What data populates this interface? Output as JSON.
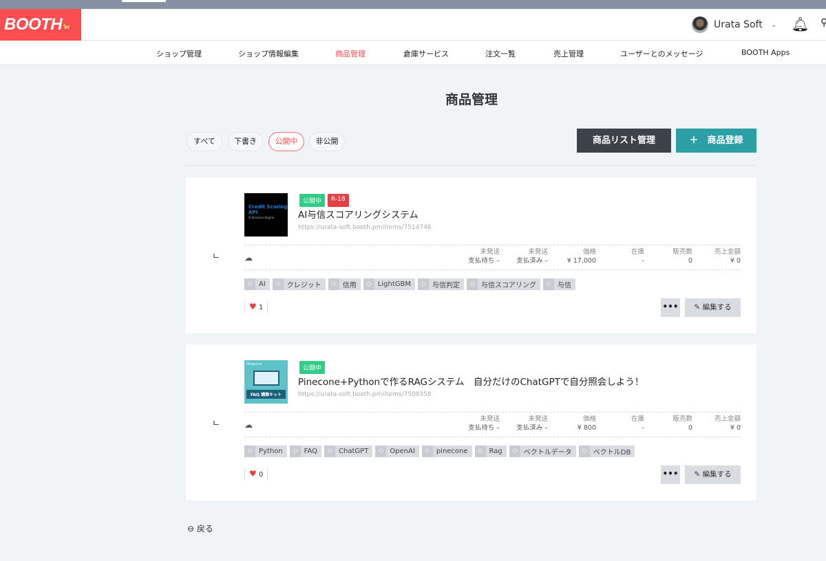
{
  "header": {
    "logo": "BOOTH",
    "user_name": "Urata Soft"
  },
  "nav": [
    "ショップ管理",
    "ショップ情報編集",
    "商品管理",
    "倉庫サービス",
    "注文一覧",
    "売上管理",
    "ユーザーとのメッセージ",
    "BOOTH Apps"
  ],
  "page_title": "商品管理",
  "filters": [
    "すべて",
    "下書き",
    "公開中",
    "非公開"
  ],
  "buttons": {
    "list_manage": "商品リスト管理",
    "register": "＋　商品登録",
    "more": "•••",
    "edit": "編集する",
    "back": "戻る"
  },
  "stat_labels": {
    "unshipped_wait": "未発送",
    "unshipped_wait2": "支払待ち –",
    "unshipped_paid": "未発送",
    "unshipped_paid2": "支払済み –",
    "price": "価格",
    "stock": "在庫",
    "sold": "販売数",
    "revenue": "売上金額"
  },
  "items": [
    {
      "status": "公開中",
      "rating": "R-18",
      "title": "AI与信スコアリングシステム",
      "url": "https://urata-soft.booth.pm/items/7514746",
      "thumb_text": "Credit Scoring API",
      "thumb_sub": "AI Decision Engine",
      "price": "¥ 17,000",
      "stock": "-",
      "sold": "0",
      "revenue": "¥ 0",
      "likes": "1",
      "tags": [
        "AI",
        "クレジット",
        "信用",
        "LightGBM",
        "与信判定",
        "与信スコアリング",
        "与信"
      ]
    },
    {
      "status": "公開中",
      "title": "Pinecone+Pythonで作るRAGシステム　自分だけのChatGPTで自分照会しよう！",
      "url": "https://urata-soft.booth.pm/items/7509358",
      "thumb_text": "Pinecone",
      "thumb_sub": "FAQ 構築キット",
      "price": "¥ 800",
      "stock": "-",
      "sold": "0",
      "revenue": "¥ 0",
      "likes": "0",
      "tags": [
        "Python",
        "FAQ",
        "ChatGPT",
        "OpenAI",
        "pinecone",
        "Rag",
        "ベクトルデータ",
        "ベクトルDB"
      ]
    }
  ]
}
